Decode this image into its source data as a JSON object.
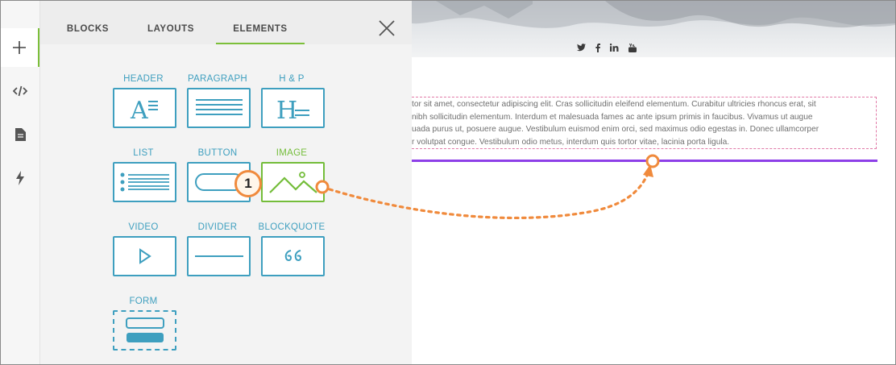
{
  "rail": {
    "items": [
      {
        "name": "add",
        "icon": "plus-icon"
      },
      {
        "name": "code",
        "icon": "code-icon"
      },
      {
        "name": "page",
        "icon": "document-icon"
      },
      {
        "name": "actions",
        "icon": "lightning-icon"
      }
    ]
  },
  "panel": {
    "tabs": [
      {
        "label": "BLOCKS"
      },
      {
        "label": "LAYOUTS"
      },
      {
        "label": "ELEMENTS",
        "active": true
      }
    ],
    "elements": [
      {
        "label": "HEADER",
        "icon": "header-icon"
      },
      {
        "label": "PARAGRAPH",
        "icon": "paragraph-icon"
      },
      {
        "label": "H & P",
        "icon": "heading-paragraph-icon"
      },
      {
        "label": "LIST",
        "icon": "list-icon"
      },
      {
        "label": "BUTTON",
        "icon": "button-icon"
      },
      {
        "label": "IMAGE",
        "icon": "image-icon",
        "highlighted": true
      },
      {
        "label": "VIDEO",
        "icon": "play-icon"
      },
      {
        "label": "DIVIDER",
        "icon": "divider-icon"
      },
      {
        "label": "BLOCKQUOTE",
        "icon": "quote-icon"
      },
      {
        "label": "FORM",
        "icon": "form-icon"
      }
    ]
  },
  "preview": {
    "social_icons": [
      "twitter-icon",
      "facebook-icon",
      "linkedin-icon",
      "youtube-icon"
    ],
    "paragraph_lines": [
      "tor sit amet, consectetur adipiscing elit. Cras sollicitudin eleifend elementum. Curabitur ultricies rhoncus erat, sit",
      "nibh sollicitudin elementum. Interdum et malesuada fames ac ante ipsum primis in faucibus. Vivamus ut augue",
      "uada purus ut, posuere augue. Vestibulum euismod enim orci, sed maximus odio egestas in. Donec ullamcorper",
      "r volutpat congue. Vestibulum odio metus, interdum quis tortor vitae, lacinia porta ligula."
    ]
  },
  "annotation": {
    "step_number": "1"
  },
  "colors": {
    "accent_green": "#74bd3a",
    "element_blue": "#3e9fbf",
    "drop_line_purple": "#8d3fe8",
    "callout_orange": "#f08a3c",
    "text_outline_pink": "#e17aa7"
  }
}
